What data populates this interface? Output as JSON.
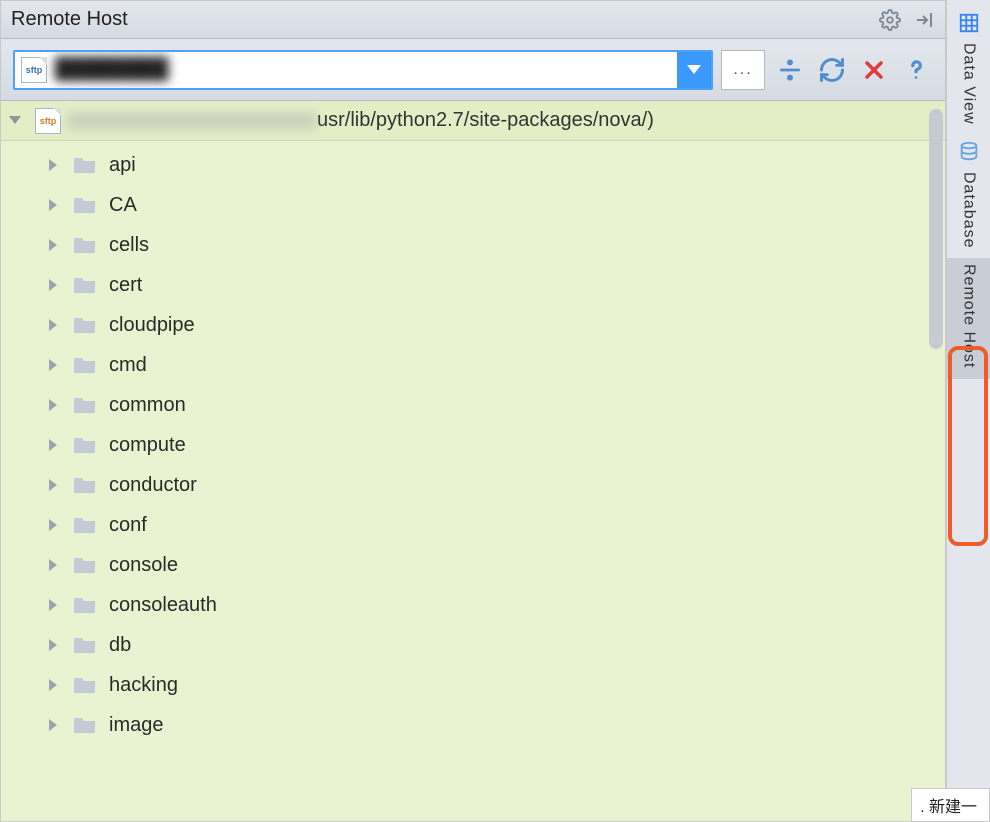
{
  "panel": {
    "title": "Remote Host"
  },
  "combo": {
    "protocol": "sftp",
    "value": "████████"
  },
  "root": {
    "protocol": "sftp",
    "path": "usr/lib/python2.7/site-packages/nova/)"
  },
  "tree": [
    {
      "name": "api"
    },
    {
      "name": "CA"
    },
    {
      "name": "cells"
    },
    {
      "name": "cert"
    },
    {
      "name": "cloudpipe"
    },
    {
      "name": "cmd"
    },
    {
      "name": "common"
    },
    {
      "name": "compute"
    },
    {
      "name": "conductor"
    },
    {
      "name": "conf"
    },
    {
      "name": "console"
    },
    {
      "name": "consoleauth"
    },
    {
      "name": "db"
    },
    {
      "name": "hacking"
    },
    {
      "name": "image"
    }
  ],
  "sideTabs": {
    "dataView": "Data View",
    "database": "Database",
    "remoteHost": "Remote Host"
  },
  "bottom": {
    "label": ". 新建一"
  }
}
